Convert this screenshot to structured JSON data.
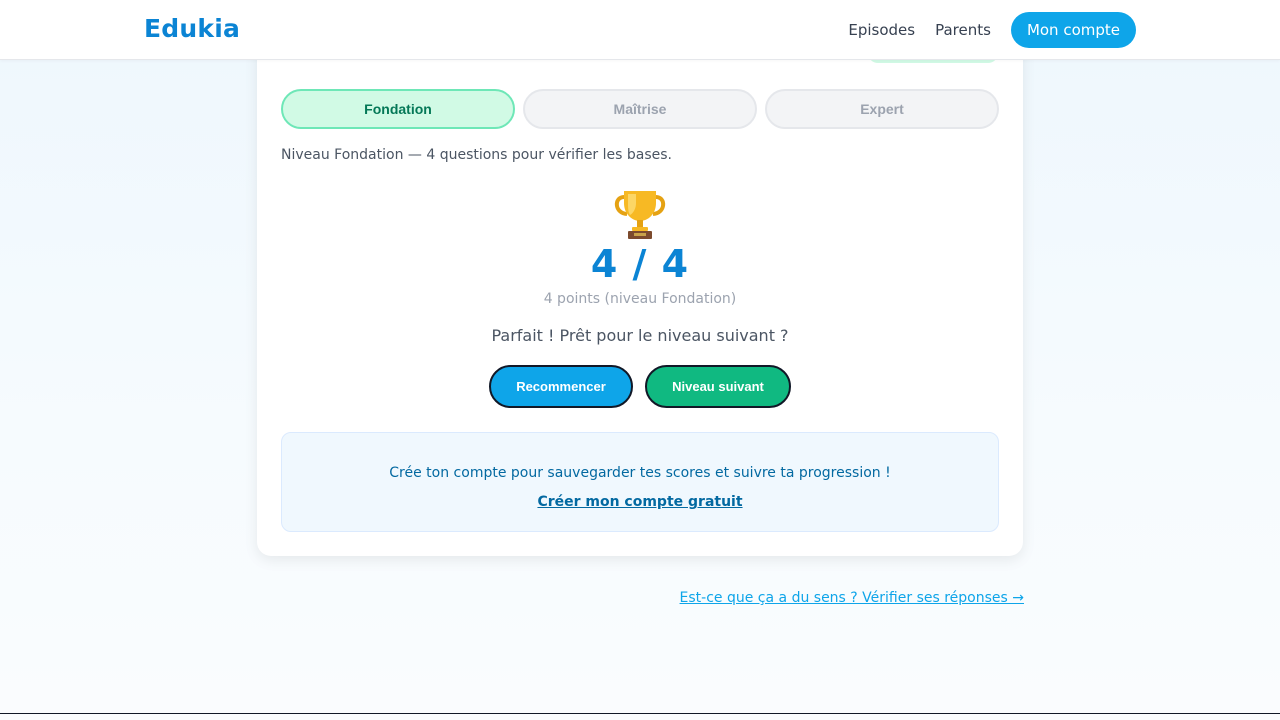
{
  "header": {
    "brand": "Edukia",
    "nav": {
      "episodes": "Episodes",
      "parents": "Parents",
      "account": "Mon compte"
    }
  },
  "quiz": {
    "levels": [
      {
        "label": "Fondation",
        "active": true
      },
      {
        "label": "Maîtrise",
        "active": false
      },
      {
        "label": "Expert",
        "active": false
      }
    ],
    "level_description": "Niveau Fondation — 4 questions pour vérifier les bases.",
    "result_icon": "trophy-icon",
    "score": "4 / 4",
    "points": "4 points (niveau Fondation)",
    "message": "Parfait ! Prêt pour le niveau suivant ?",
    "restart_label": "Recommencer",
    "next_label": "Niveau suivant"
  },
  "cta": {
    "text": "Crée ton compte pour sauvegarder tes scores et suivre ta progression !",
    "link": "Créer mon compte gratuit"
  },
  "footer_link": "Est-ce que ça a du sens ? Vérifier ses réponses →",
  "colors": {
    "brand": "#0b84d4",
    "primary_button": "#0ea5e9",
    "success_button": "#10b981",
    "active_level_bg": "#d1fae5",
    "active_level_text": "#047857"
  }
}
